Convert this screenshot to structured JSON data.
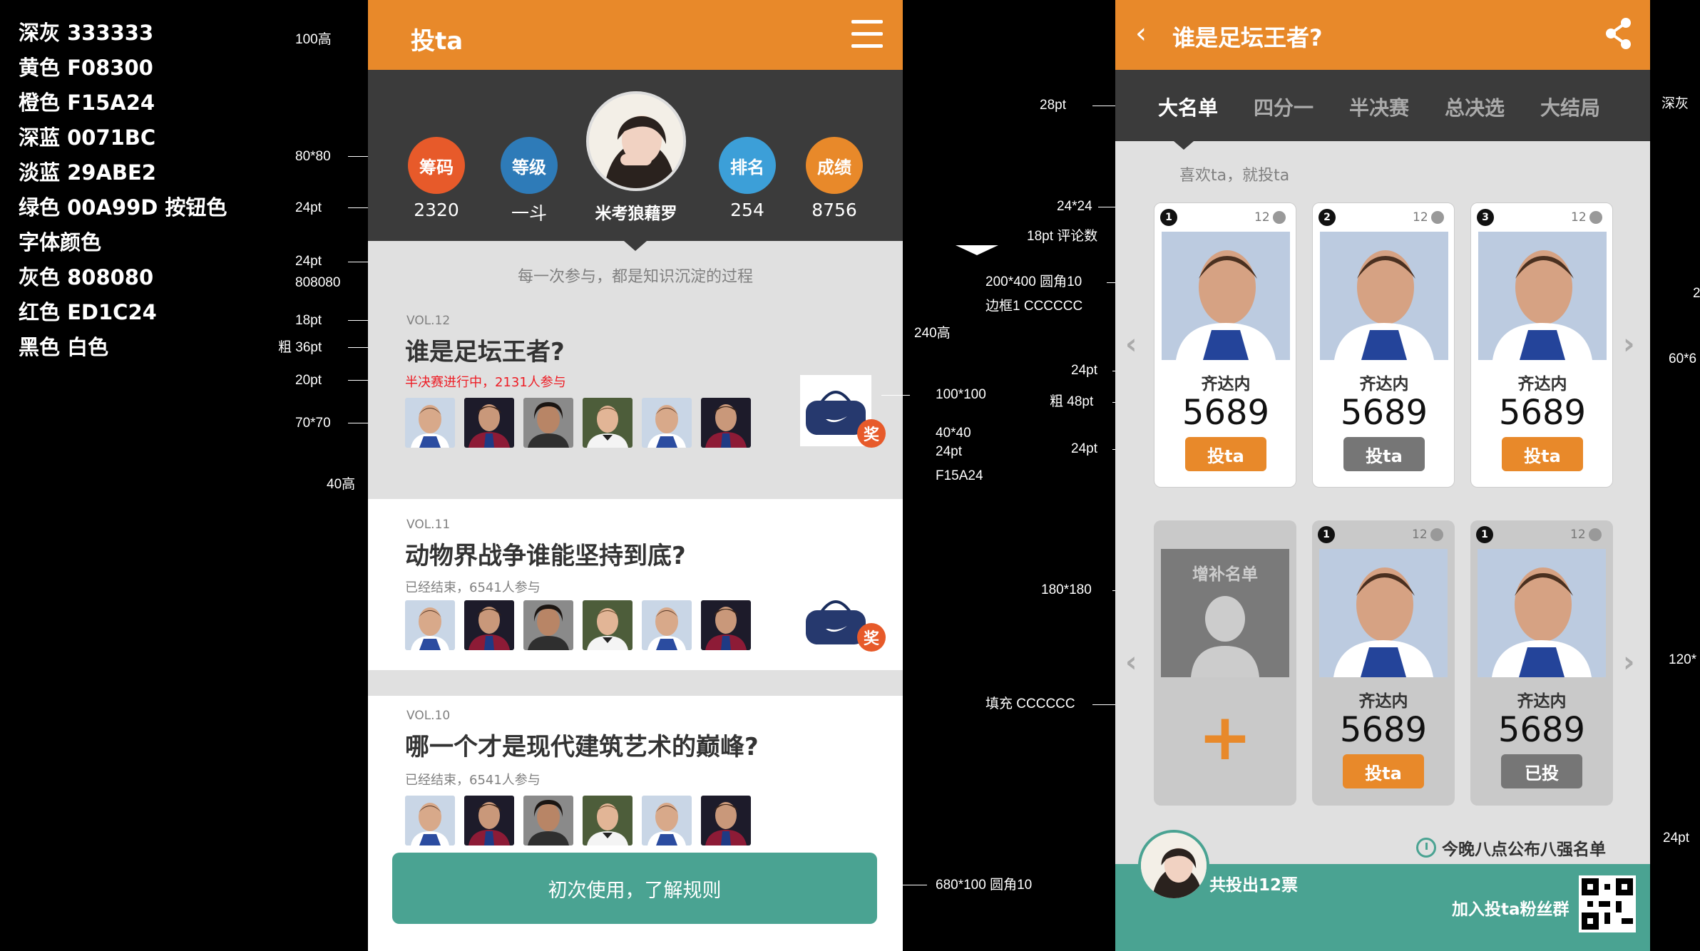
{
  "colors": {
    "dark_gray": "#333333",
    "yellow": "#F08300",
    "orange": "#F15A24",
    "deep_blue": "#0071BC",
    "light_blue": "#29ABE2",
    "green": "#00A99D",
    "gray": "#808080",
    "red": "#ED1C24"
  },
  "legend": [
    "深灰  333333",
    "黄色  F08300",
    "橙色  F15A24",
    "深蓝  0071BC",
    "淡蓝  29ABE2",
    "绿色  00A99D  按钮色",
    "字体颜色",
    "灰色  808080",
    "红色  ED1C24",
    "黑色  白色"
  ],
  "notes_left": {
    "n100": "100高",
    "n8080": "80*80",
    "n24a": "24pt",
    "n24b": "24pt",
    "n808080": "808080",
    "n18": "18pt",
    "n36": "粗 36pt",
    "n20": "20pt",
    "n7070": "70*70",
    "n40h": "40高"
  },
  "notes_middle": {
    "n240": "240高",
    "n100100": "100*100",
    "n4040": "40*40",
    "n24pt": "24pt",
    "nf15": "F15A24",
    "n680": "680*100 圆角10",
    "n2424": "24*24",
    "n18cmt": "18pt 评论数",
    "n28": "28pt",
    "n200": "200*400 圆角10",
    "nborder": "边框1 CCCCCC",
    "n24pt2": "24pt",
    "n48": "粗 48pt",
    "n24pt3": "24pt",
    "n180": "180*180",
    "nfill": "填充 CCCCCC"
  },
  "notes_right": {
    "ndark": "深灰",
    "n2": "2",
    "n60": "60*6",
    "n120": "120*",
    "n24pt": "24pt"
  },
  "app1": {
    "title": "投ta",
    "stats": [
      {
        "label": "筹码",
        "value": "2320",
        "color": "#e75a2a"
      },
      {
        "label": "等级",
        "value": "一斗",
        "color": "#2e7bb8"
      },
      {
        "label": "排名",
        "value": "254",
        "color": "#3c9fd8"
      },
      {
        "label": "成绩",
        "value": "8756",
        "color": "#e8892a"
      }
    ],
    "username": "米考狼藉罗",
    "tagline": "每一次参与，都是知识沉淀的过程",
    "cards": [
      {
        "vol": "VOL.12",
        "title": "谁是足坛王者?",
        "status": "半决赛进行中，2131人参与",
        "status_color": "#ED1C24",
        "prize_label": "奖"
      },
      {
        "vol": "VOL.11",
        "title": "动物界战争谁能坚持到底?",
        "status": "已经结束，6541人参与",
        "status_color": "#808080",
        "prize_label": "奖"
      },
      {
        "vol": "VOL.10",
        "title": "哪一个才是现代建筑艺术的巅峰?",
        "status": "已经结束，6541人参与",
        "status_color": "#808080"
      }
    ],
    "rules_button": "初次使用，了解规则"
  },
  "app2": {
    "title": "谁是足坛王者?",
    "tabs": [
      "大名单",
      "四分一",
      "半决赛",
      "总决选",
      "大结局"
    ],
    "active_tab": 0,
    "subtitle": "喜欢ta，就投ta",
    "players_row1": [
      {
        "rank": "1",
        "comments": "12",
        "name": "齐达内",
        "score": "5689",
        "button": "投ta",
        "button_style": "orange"
      },
      {
        "rank": "2",
        "comments": "12",
        "name": "齐达内",
        "score": "5689",
        "button": "投ta",
        "button_style": "gray"
      },
      {
        "rank": "3",
        "comments": "12",
        "name": "齐达内",
        "score": "5689",
        "button": "投ta",
        "button_style": "orange"
      }
    ],
    "add_card": {
      "label": "增补名单",
      "plus": "+"
    },
    "players_row2": [
      {
        "rank": "1",
        "comments": "12",
        "name": "齐达内",
        "score": "5689",
        "button": "投ta",
        "button_style": "orange"
      },
      {
        "rank": "1",
        "comments": "12",
        "name": "齐达内",
        "score": "5689",
        "button": "已投",
        "button_style": "gray"
      }
    ],
    "notice": "今晚八点公布八强名单",
    "votes": "共投出12票",
    "join": "加入投ta粉丝群"
  }
}
